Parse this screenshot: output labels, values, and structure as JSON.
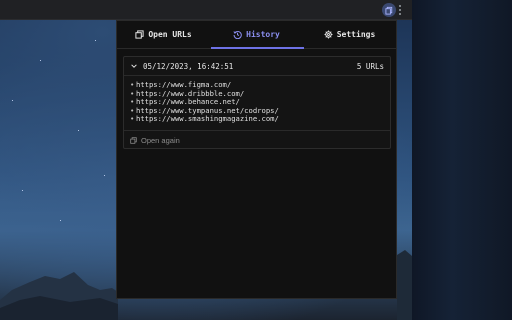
{
  "tabs": [
    {
      "label": "Open URLs",
      "icon": "copy-icon"
    },
    {
      "label": "History",
      "icon": "history-icon",
      "active": true
    },
    {
      "label": "Settings",
      "icon": "gear-icon"
    }
  ],
  "history": {
    "entries": [
      {
        "timestamp": "05/12/2023, 16:42:51",
        "count_label": "5 URLs",
        "urls": [
          "https://www.figma.com/",
          "https://www.dribbble.com/",
          "https://www.behance.net/",
          "https://www.tympanus.net/codrops/",
          "https://www.smashingmagazine.com/"
        ],
        "bullet": "•",
        "action_label": "Open again"
      }
    ]
  },
  "colors": {
    "accent": "#6e72e6",
    "popup_bg": "#111111",
    "border": "#2a2a2a"
  }
}
